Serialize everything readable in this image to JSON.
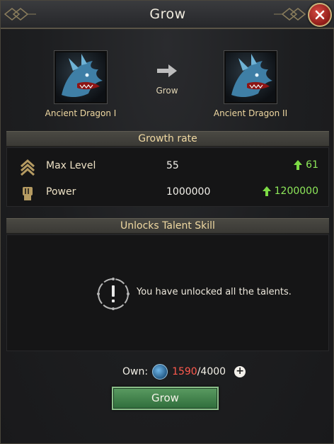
{
  "window": {
    "title": "Grow",
    "close_icon": "close-icon"
  },
  "upgrade": {
    "from_name": "Ancient Dragon I",
    "to_name": "Ancient Dragon II",
    "action_label": "Grow"
  },
  "growth_rate": {
    "header": "Growth rate",
    "stats": [
      {
        "icon": "chevrons-up-icon",
        "label": "Max Level",
        "current": "55",
        "new": "61"
      },
      {
        "icon": "fist-icon",
        "label": "Power",
        "current": "1000000",
        "new": "1200000"
      }
    ]
  },
  "talents": {
    "header": "Unlocks Talent Skill",
    "message": "You have unlocked all the talents.",
    "icon": "exclamation-icon"
  },
  "own": {
    "label": "Own:",
    "count": "1590",
    "separator": "/",
    "required": "4000",
    "plus": "+"
  },
  "grow_button_label": "Grow",
  "colors": {
    "accent_gold": "#f0d9a2",
    "increase_green": "#8ee85a",
    "insufficient_red": "#ff5a4e",
    "button_green": "#3f8249",
    "close_red": "#b3302a"
  }
}
